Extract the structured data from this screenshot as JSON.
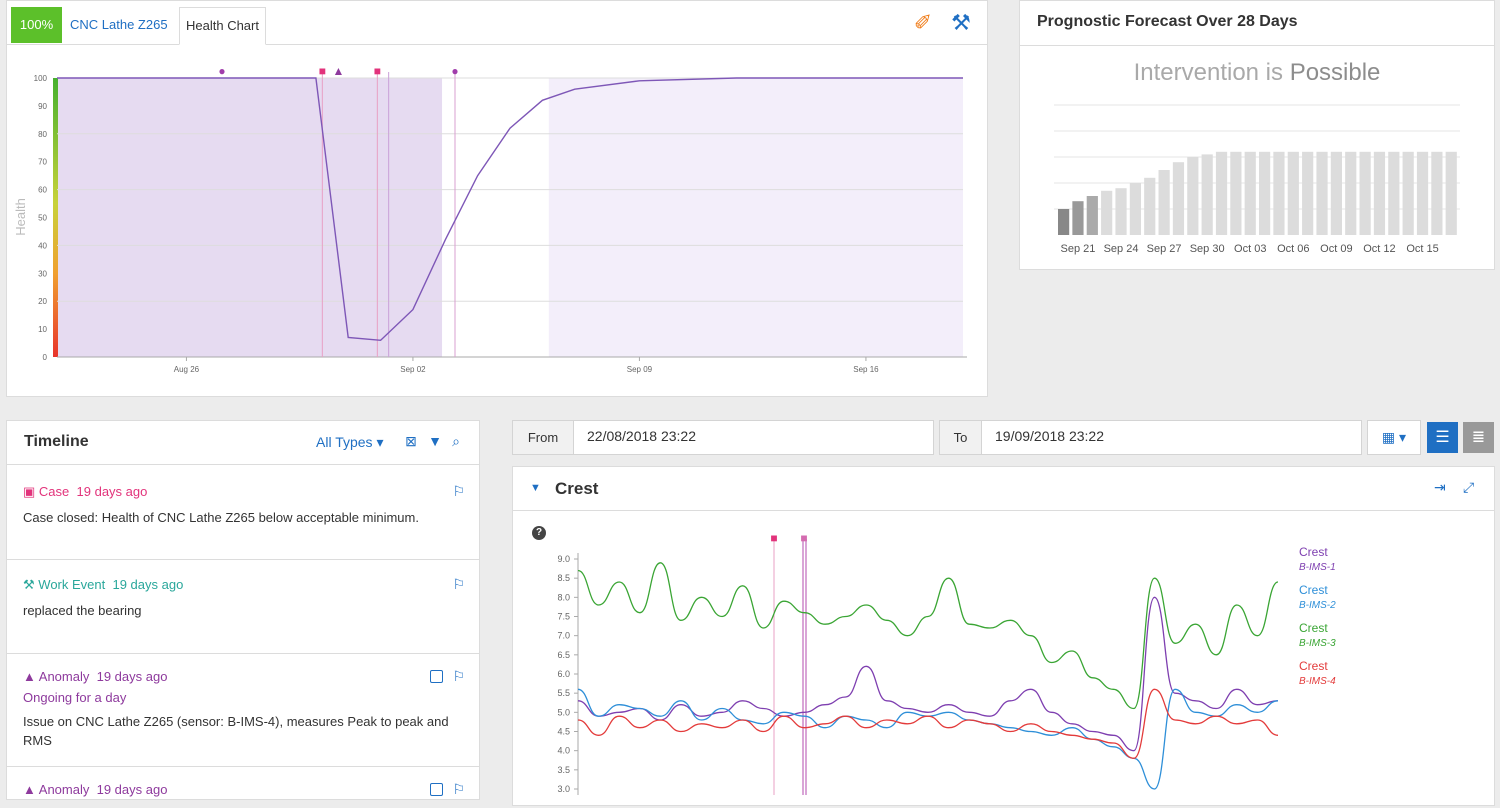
{
  "health": {
    "badge": "100%",
    "machine_tab": "CNC Lathe Z265",
    "chart_tab": "Health Chart"
  },
  "forecast": {
    "title": "Prognostic Forecast Over 28 Days",
    "subtitle_prefix": "Intervention is",
    "subtitle_state": "Possible"
  },
  "timeline": {
    "title": "Timeline",
    "filter_label": "All Types",
    "items": [
      {
        "kind": "Case",
        "ago": "19 days ago",
        "text": "Case closed: Health of CNC Lathe Z265 below acceptable minimum.",
        "sub": ""
      },
      {
        "kind": "Work Event",
        "ago": "19 days ago",
        "text": "replaced the bearing",
        "sub": ""
      },
      {
        "kind": "Anomaly",
        "ago": "19 days ago",
        "text": "Issue on CNC Lathe Z265 (sensor: B-IMS-4), measures Peak to peak and RMS",
        "sub": "Ongoing for a day"
      },
      {
        "kind": "Anomaly",
        "ago": "19 days ago",
        "text": "",
        "sub": ""
      }
    ]
  },
  "range": {
    "from_label": "From",
    "from_value": "22/08/2018 23:22",
    "to_label": "To",
    "to_value": "19/09/2018 23:22"
  },
  "crest": {
    "title": "Crest",
    "legend": [
      {
        "name": "Crest",
        "sensor": "B-IMS-1",
        "color": "#7e3fb0"
      },
      {
        "name": "Crest",
        "sensor": "B-IMS-2",
        "color": "#2e8fd8"
      },
      {
        "name": "Crest",
        "sensor": "B-IMS-3",
        "color": "#3aa534"
      },
      {
        "name": "Crest",
        "sensor": "B-IMS-4",
        "color": "#e33b3b"
      }
    ]
  },
  "chart_data": [
    {
      "type": "line",
      "ylabel": "Health",
      "ylim": [
        0,
        100
      ],
      "yticks": [
        0,
        10,
        20,
        30,
        40,
        50,
        60,
        70,
        80,
        90,
        100
      ],
      "xticks": [
        "Aug 26",
        "Sep 02",
        "Sep 09",
        "Sep 16"
      ],
      "x": [
        "Aug 22",
        "Aug 30",
        "Aug 31",
        "Sep 01",
        "Sep 02",
        "Sep 03",
        "Sep 04",
        "Sep 05",
        "Sep 06",
        "Sep 07",
        "Sep 09",
        "Sep 12",
        "Sep 19"
      ],
      "values": [
        100,
        100,
        7,
        6,
        17,
        42,
        65,
        82,
        92,
        96,
        99,
        100,
        100
      ],
      "color": "#7e57b7"
    },
    {
      "type": "bar",
      "categories": [
        "Sep 21",
        "Sep 24",
        "Sep 27",
        "Sep 30",
        "Oct 03",
        "Oct 06",
        "Oct 09",
        "Oct 12",
        "Oct 15"
      ],
      "values": [
        10,
        13,
        15,
        17,
        18,
        20,
        22,
        25,
        28,
        30,
        31,
        32,
        32,
        32,
        32,
        32,
        32,
        32,
        32,
        32,
        32,
        32,
        32,
        32,
        32,
        32,
        32,
        32
      ],
      "ylim": [
        0,
        50
      ]
    },
    {
      "type": "line",
      "ylim": [
        3.0,
        9.0
      ],
      "yticks": [
        "3.0",
        "3.5",
        "4.0",
        "4.5",
        "5.0",
        "5.5",
        "6.0",
        "6.5",
        "7.0",
        "7.5",
        "8.0",
        "8.5",
        "9.0"
      ],
      "series": [
        {
          "name": "Crest B-IMS-1",
          "color": "#7e3fb0",
          "values": [
            5.3,
            4.9,
            5.0,
            5.1,
            4.8,
            5.2,
            4.9,
            5.0,
            5.3,
            5.1,
            4.9,
            5.0,
            5.2,
            5.4,
            6.2,
            5.3,
            5.1,
            5.0,
            5.2,
            5.0,
            4.9,
            5.3,
            5.6,
            5.0,
            4.7,
            4.5,
            4.4,
            4.0,
            8.0,
            5.5,
            5.3,
            5.1,
            5.6,
            5.2,
            5.3
          ]
        },
        {
          "name": "Crest B-IMS-2",
          "color": "#2e8fd8",
          "values": [
            5.6,
            4.9,
            5.2,
            5.1,
            4.9,
            5.3,
            4.8,
            5.1,
            4.8,
            4.7,
            5.0,
            4.9,
            4.6,
            4.9,
            4.8,
            4.6,
            5.0,
            4.9,
            5.0,
            4.8,
            4.7,
            4.6,
            4.5,
            4.4,
            4.6,
            4.3,
            4.1,
            3.8,
            3.0,
            5.6,
            5.0,
            4.9,
            5.2,
            5.0,
            5.3
          ]
        },
        {
          "name": "Crest B-IMS-3",
          "color": "#3aa534",
          "values": [
            8.7,
            7.8,
            8.4,
            7.6,
            8.9,
            7.4,
            8.0,
            7.5,
            8.3,
            7.2,
            7.9,
            7.6,
            7.3,
            7.5,
            7.8,
            7.4,
            7.0,
            7.5,
            8.5,
            7.3,
            7.2,
            7.4,
            7.0,
            6.3,
            6.6,
            5.9,
            5.6,
            5.1,
            8.5,
            6.8,
            7.3,
            6.5,
            7.8,
            7.0,
            8.4
          ]
        },
        {
          "name": "Crest B-IMS-4",
          "color": "#e33b3b",
          "values": [
            4.8,
            4.4,
            4.9,
            4.6,
            4.8,
            4.5,
            4.7,
            4.6,
            4.8,
            4.5,
            4.9,
            4.6,
            4.7,
            4.9,
            4.6,
            4.8,
            4.7,
            4.9,
            4.6,
            4.8,
            4.7,
            4.5,
            4.7,
            4.5,
            4.4,
            4.3,
            4.2,
            3.8,
            5.6,
            4.8,
            4.7,
            4.9,
            4.7,
            4.8,
            4.4
          ]
        }
      ]
    }
  ]
}
